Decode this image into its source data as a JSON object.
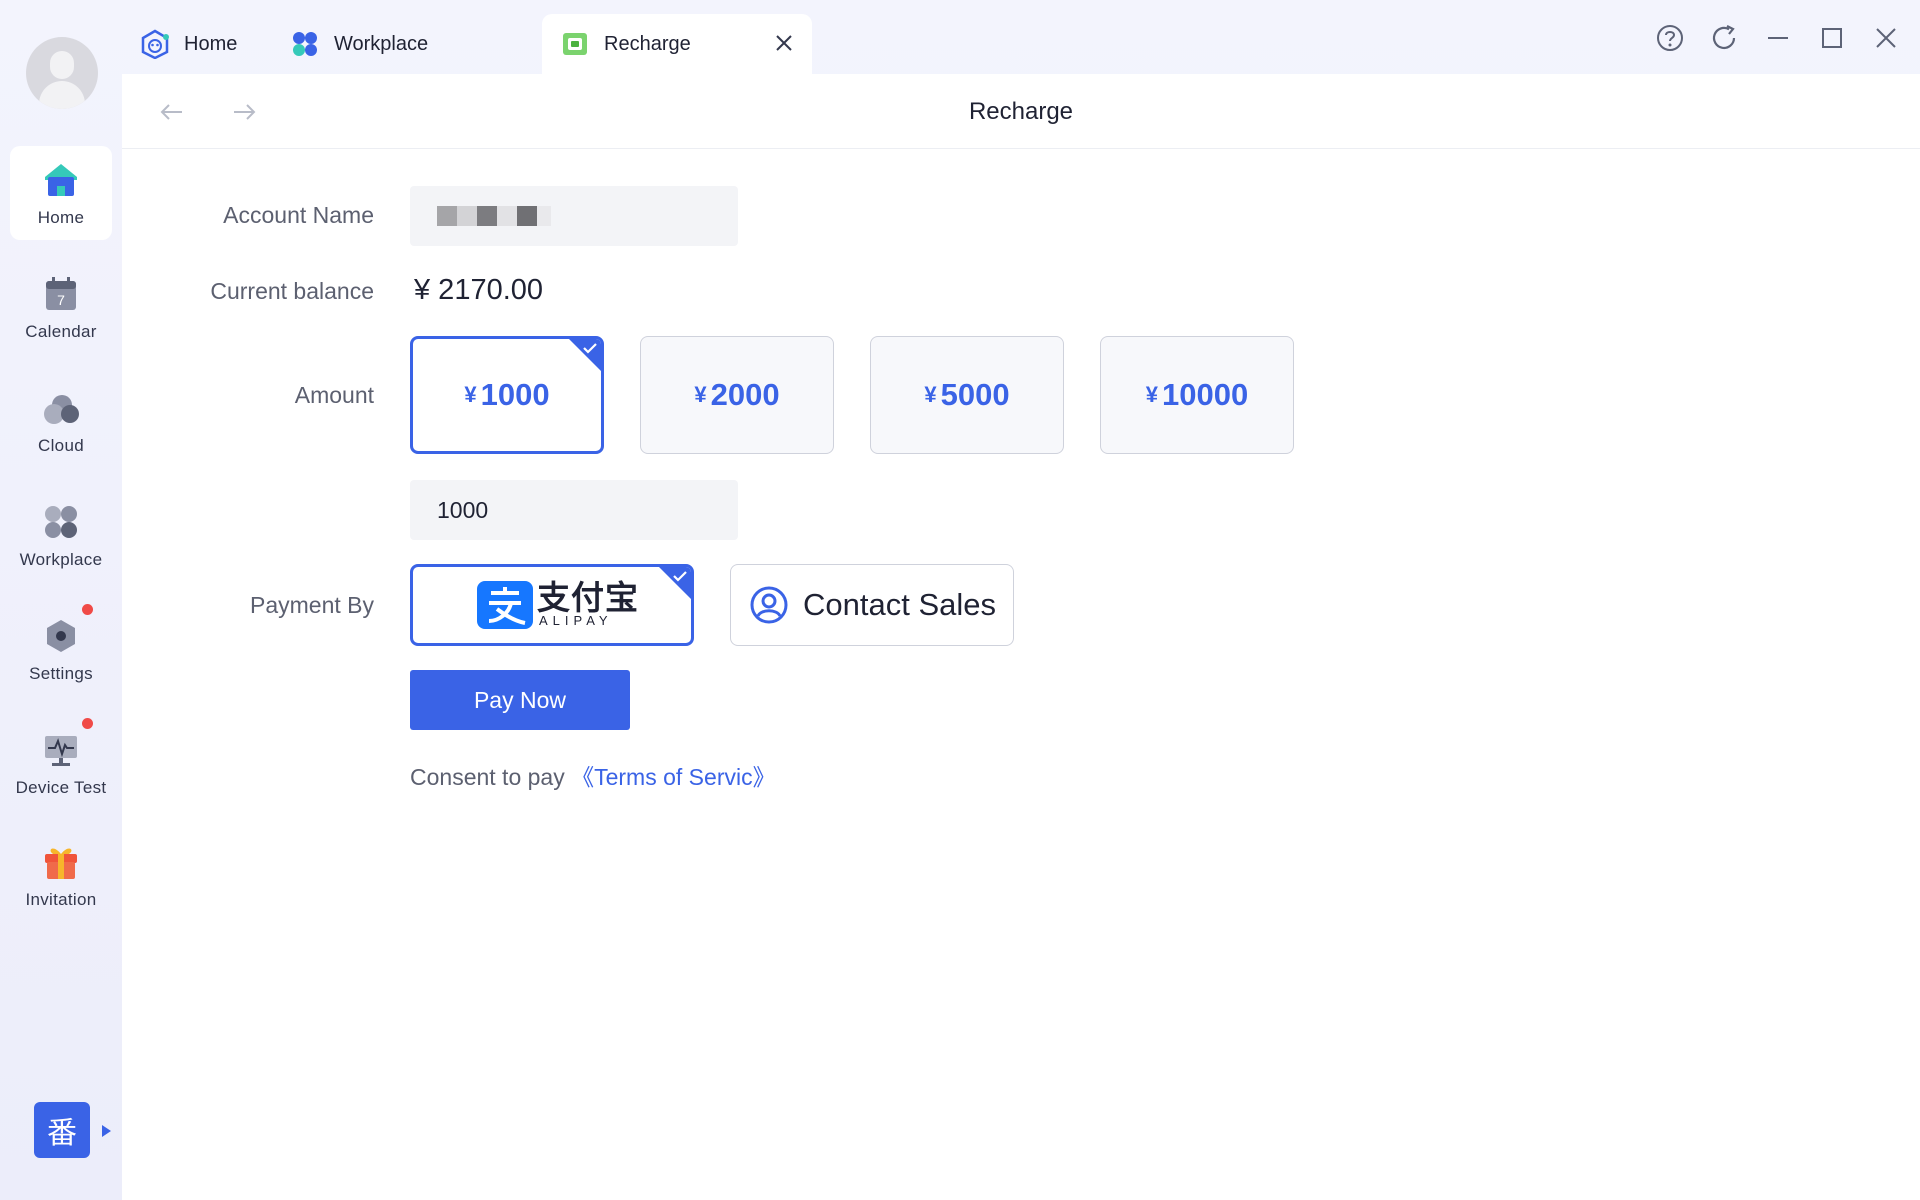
{
  "sidebar": {
    "items": [
      {
        "label": "Home"
      },
      {
        "label": "Calendar",
        "icon_text": "7"
      },
      {
        "label": "Cloud"
      },
      {
        "label": "Workplace"
      },
      {
        "label": "Settings"
      },
      {
        "label": "Device Test"
      },
      {
        "label": "Invitation"
      }
    ],
    "translate_icon": "番"
  },
  "tabs": [
    {
      "label": "Home"
    },
    {
      "label": "Workplace"
    },
    {
      "label": "Recharge"
    }
  ],
  "page": {
    "title": "Recharge",
    "account_label": "Account Name",
    "balance_label": "Current balance",
    "balance_value": "¥ 2170.00",
    "amount_label": "Amount",
    "amount_options": [
      {
        "symbol": "¥",
        "value": "1000"
      },
      {
        "symbol": "¥",
        "value": "2000"
      },
      {
        "symbol": "¥",
        "value": "5000"
      },
      {
        "symbol": "¥",
        "value": "10000"
      }
    ],
    "selected_amount_index": 0,
    "amount_input_value": "1000",
    "payment_label": "Payment By",
    "alipay": {
      "cn": "支付宝",
      "en": "ALIPAY"
    },
    "contact_sales": "Contact Sales",
    "pay_now": "Pay Now",
    "consent_text": "Consent to pay ",
    "terms_link": "《Terms of Servic》"
  },
  "colors": {
    "accent": "#3a63e6",
    "badge": "#f04a47"
  }
}
